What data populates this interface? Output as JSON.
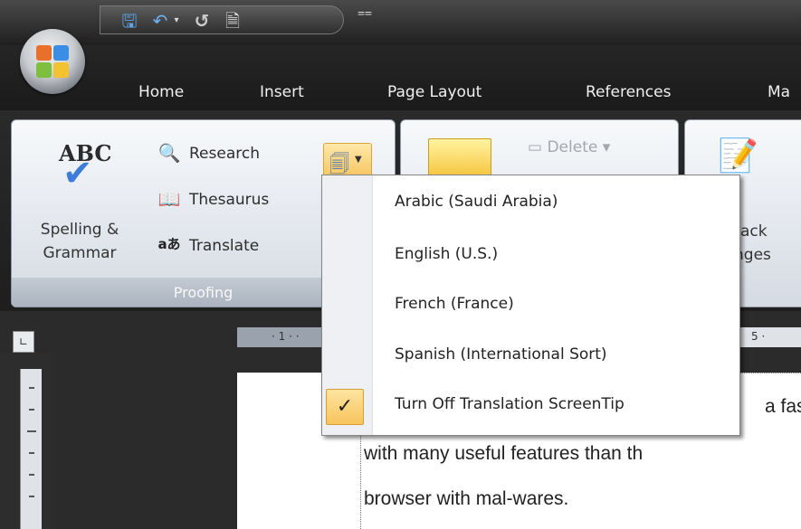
{
  "title_bar": {
    "quick_access": {
      "save_icon": "save-icon",
      "undo_icon": "undo-icon",
      "redo_icon": "redo-icon",
      "print_preview_icon": "print-preview-icon",
      "customize_icon": "customize-qat-icon"
    }
  },
  "tabs": [
    "Home",
    "Insert",
    "Page Layout",
    "References",
    "Ma"
  ],
  "ribbon": {
    "proofing": {
      "group_label": "Proofing",
      "spelling_label_1": "Spelling &",
      "spelling_label_2": "Grammar",
      "abc": "ABC",
      "research": "Research",
      "thesaurus": "Thesaurus",
      "translate": "Translate"
    },
    "comments": {
      "delete": "Delete"
    },
    "tracking": {
      "track_label_1": "rack",
      "track_label_2": "nges"
    }
  },
  "ruler": {
    "mark_1": "· 1 · ·",
    "mark_5": "5 ·"
  },
  "translation_menu": {
    "items": [
      {
        "label": "Arabic (Saudi Arabia)",
        "checked": false
      },
      {
        "label": "English (U.S.)",
        "checked": false
      },
      {
        "label": "French (France)",
        "checked": false
      },
      {
        "label": "Spanish (International Sort)",
        "checked": false
      },
      {
        "label": "Turn Off Translation ScreenTip",
        "checked": true
      }
    ]
  },
  "document": {
    "line_1": "a fas",
    "line_2": "with many  useful features than th",
    "line_3": "browser with mal-wares."
  },
  "colors": {
    "menu_highlight": "#f8c45c",
    "ribbon_bg": "#e4e8ee",
    "window_frame": "#1f1f1f"
  }
}
